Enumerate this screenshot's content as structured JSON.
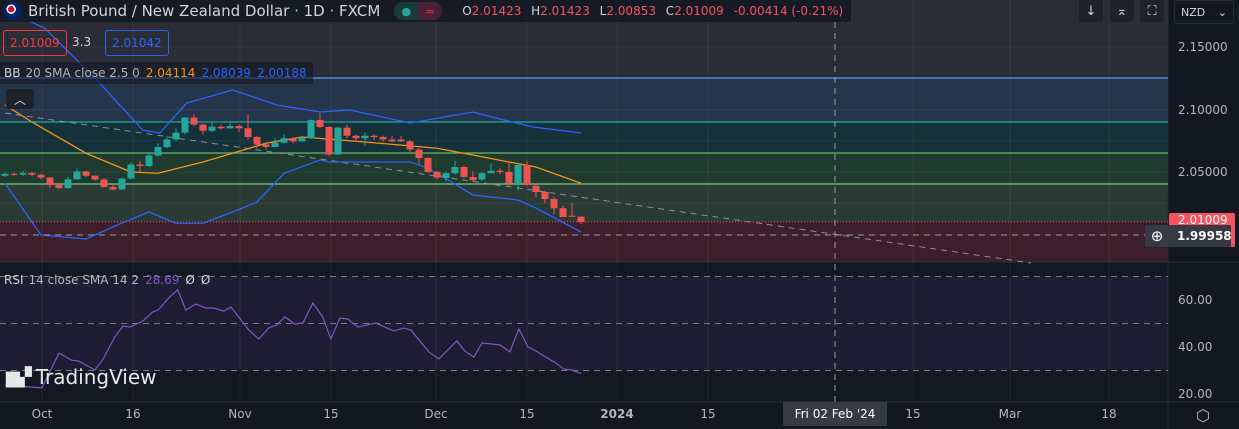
{
  "header": {
    "symbol_title": "British Pound / New Zealand Dollar · 1D · FXCM",
    "market_status_icon": "green-dot-icon",
    "data_delay_icon": "approx-icon",
    "ohlc": {
      "o_label": "O",
      "o": "2.01423",
      "h_label": "H",
      "h": "2.01423",
      "l_label": "L",
      "l": "2.00853",
      "c_label": "C",
      "c": "2.01009",
      "change": "-0.00414 (-0.21%)"
    },
    "sell_price": "2.01009",
    "spread": "3.3",
    "buy_price": "2.01042"
  },
  "indicators": {
    "bb": {
      "name": "BB",
      "params": "20 SMA close 2.5 0",
      "basis": "2.04114",
      "upper": "2.08039",
      "lower": "2.00188"
    },
    "rsi": {
      "name": "RSI",
      "params": "14 close SMA 14 2",
      "value": "28.69",
      "ma_value": "Ø",
      "extra": "Ø"
    }
  },
  "toolbar": {
    "currency": "NZD",
    "buttons": [
      "arrow-down-icon",
      "collapse-icon",
      "fullscreen-icon"
    ]
  },
  "price_axis": {
    "ticks": [
      "2.15000",
      "2.10000",
      "2.05000"
    ],
    "last_price": "2.01009",
    "crosshair_price": "1.99958"
  },
  "rsi_axis": {
    "ticks": [
      "60.00",
      "40.00",
      "20.00"
    ]
  },
  "time_axis": {
    "ticks": [
      "Oct",
      "16",
      "Nov",
      "15",
      "Dec",
      "15",
      "2024",
      "15",
      "15",
      "Mar",
      "18"
    ],
    "crosshair_date": "Fri 02 Feb '24"
  },
  "watermark": "TradingView",
  "colors": {
    "up": "#26a69a",
    "down": "#ef5350",
    "bb_basis": "#f7931a",
    "bb_band": "#2962ff",
    "rsi": "#7e57c2",
    "last_price": "#f7525f"
  },
  "chart_data": {
    "type": "candlestick",
    "price_range": [
      1.98,
      2.18
    ],
    "levels": [
      2.1252,
      2.09,
      2.0652,
      2.0404
    ],
    "candles": [
      [
        2.047,
        2.05,
        2.046,
        2.0485
      ],
      [
        2.0485,
        2.0495,
        2.047,
        2.048
      ],
      [
        2.048,
        2.051,
        2.047,
        2.0492
      ],
      [
        2.0492,
        2.05,
        2.0465,
        2.0478
      ],
      [
        2.0478,
        2.0485,
        2.044,
        2.0455
      ],
      [
        2.0455,
        2.046,
        2.037,
        2.0395
      ],
      [
        2.0395,
        2.041,
        2.036,
        2.0372
      ],
      [
        2.0372,
        2.046,
        2.0365,
        2.0442
      ],
      [
        2.0442,
        2.053,
        2.044,
        2.0505
      ],
      [
        2.0505,
        2.051,
        2.046,
        2.047
      ],
      [
        2.047,
        2.0475,
        2.043,
        2.044
      ],
      [
        2.044,
        2.045,
        2.0375,
        2.038
      ],
      [
        2.038,
        2.0395,
        2.0355,
        2.036
      ],
      [
        2.036,
        2.045,
        2.0355,
        2.0448
      ],
      [
        2.0448,
        2.0575,
        2.044,
        2.056
      ],
      [
        2.056,
        2.059,
        2.05,
        2.0548
      ],
      [
        2.0548,
        2.065,
        2.054,
        2.0632
      ],
      [
        2.0632,
        2.073,
        2.062,
        2.07
      ],
      [
        2.07,
        2.079,
        2.069,
        2.076
      ],
      [
        2.076,
        2.085,
        2.075,
        2.0815
      ],
      [
        2.0815,
        2.094,
        2.08,
        2.0935
      ],
      [
        2.0935,
        2.096,
        2.087,
        2.088
      ],
      [
        2.088,
        2.0885,
        2.08,
        2.083
      ],
      [
        2.083,
        2.09,
        2.082,
        2.0862
      ],
      [
        2.0862,
        2.088,
        2.084,
        2.085
      ],
      [
        2.085,
        2.089,
        2.0845,
        2.0868
      ],
      [
        2.0868,
        2.088,
        2.082,
        2.085
      ],
      [
        2.085,
        2.096,
        2.076,
        2.078
      ],
      [
        2.078,
        2.079,
        2.069,
        2.072
      ],
      [
        2.072,
        2.073,
        2.068,
        2.07
      ],
      [
        2.07,
        2.077,
        2.07,
        2.0735
      ],
      [
        2.0735,
        2.08,
        2.073,
        2.077
      ],
      [
        2.077,
        2.078,
        2.073,
        2.0745
      ],
      [
        2.0745,
        2.079,
        2.0745,
        2.077
      ],
      [
        2.077,
        2.092,
        2.0765,
        2.0915
      ],
      [
        2.0915,
        2.097,
        2.085,
        2.086
      ],
      [
        2.086,
        2.087,
        2.063,
        2.064
      ],
      [
        2.064,
        2.086,
        2.0635,
        2.0855
      ],
      [
        2.0855,
        2.088,
        2.077,
        2.079
      ],
      [
        2.079,
        2.08,
        2.074,
        2.077
      ],
      [
        2.077,
        2.0815,
        2.071,
        2.079
      ],
      [
        2.079,
        2.08,
        2.0755,
        2.078
      ],
      [
        2.078,
        2.079,
        2.074,
        2.076
      ],
      [
        2.076,
        2.079,
        2.074,
        2.0745
      ],
      [
        2.076,
        2.079,
        2.074,
        2.0745
      ],
      [
        2.0745,
        2.0755,
        2.066,
        2.068
      ],
      [
        2.068,
        2.069,
        2.056,
        2.0612
      ],
      [
        2.0612,
        2.062,
        2.049,
        2.05
      ],
      [
        2.05,
        2.051,
        2.044,
        2.0455
      ],
      [
        2.0452,
        2.0505,
        2.0425,
        2.049
      ],
      [
        2.049,
        2.059,
        2.048,
        2.054
      ],
      [
        2.054,
        2.055,
        2.045,
        2.046
      ],
      [
        2.046,
        2.0505,
        2.042,
        2.0435
      ],
      [
        2.044,
        2.05,
        2.043,
        2.049
      ],
      [
        2.049,
        2.057,
        2.049,
        2.051
      ],
      [
        2.051,
        2.053,
        2.048,
        2.05
      ],
      [
        2.05,
        2.059,
        2.038,
        2.041
      ],
      [
        2.0404,
        2.056,
        2.035,
        2.0556
      ],
      [
        2.0556,
        2.059,
        2.039,
        2.0396
      ],
      [
        2.039,
        2.04,
        2.03,
        2.034
      ],
      [
        2.034,
        2.035,
        2.025,
        2.0284
      ],
      [
        2.0284,
        2.03,
        2.016,
        2.021
      ],
      [
        2.021,
        2.023,
        2.014,
        2.014
      ],
      [
        2.015,
        2.025,
        2.0145,
        2.0148
      ],
      [
        2.01423,
        2.01423,
        2.00853,
        2.01009
      ]
    ],
    "bb_upper": [
      [
        0,
        2.1796
      ],
      [
        4.4,
        2.1652
      ],
      [
        10.2,
        2.1236
      ],
      [
        15.3,
        2.0836
      ],
      [
        17.2,
        2.0812
      ],
      [
        20.2,
        2.1052
      ],
      [
        25.3,
        2.1156
      ],
      [
        30.2,
        2.1036
      ],
      [
        35,
        2.098
      ],
      [
        38.3,
        2.0996
      ],
      [
        45,
        2.0892
      ],
      [
        52,
        2.098
      ],
      [
        55,
        2.0924
      ],
      [
        58.7,
        2.086
      ],
      [
        64,
        2.0812
      ]
    ],
    "bb_basis": [
      [
        0,
        2.1036
      ],
      [
        3,
        2.09
      ],
      [
        9,
        2.065
      ],
      [
        14,
        2.05
      ],
      [
        17,
        2.049
      ],
      [
        22,
        2.058
      ],
      [
        29,
        2.073
      ],
      [
        33,
        2.078
      ],
      [
        40,
        2.074
      ],
      [
        48,
        2.069
      ],
      [
        52,
        2.0636
      ],
      [
        56,
        2.058
      ],
      [
        59,
        2.054
      ],
      [
        64,
        2.041
      ]
    ],
    "bb_lower": [
      [
        0,
        2.041
      ],
      [
        4,
        1.9996
      ],
      [
        9,
        1.9964
      ],
      [
        13,
        2.0092
      ],
      [
        16,
        2.018
      ],
      [
        19,
        2.009
      ],
      [
        22,
        2.009
      ],
      [
        25,
        2.0172
      ],
      [
        28,
        2.026
      ],
      [
        31,
        2.049
      ],
      [
        35,
        2.0596
      ],
      [
        36,
        2.058
      ],
      [
        45,
        2.058
      ],
      [
        47,
        2.0532
      ],
      [
        52,
        2.0316
      ],
      [
        57,
        2.0276
      ],
      [
        59,
        2.0212
      ],
      [
        64,
        2.002
      ]
    ],
    "trend_line": [
      [
        0,
        2.0972
      ],
      [
        114,
        1.9772
      ]
    ],
    "rsi_range": [
      10,
      80
    ],
    "rsi_levels": [
      70,
      50,
      30
    ],
    "rsi": [
      [
        0,
        23.8
      ],
      [
        4.1,
        22.6
      ],
      [
        6,
        37.4
      ],
      [
        7.4,
        34.4
      ],
      [
        8.2,
        34
      ],
      [
        10,
        30.2
      ],
      [
        10.9,
        34.9
      ],
      [
        12.2,
        44.3
      ],
      [
        13.1,
        48.9
      ],
      [
        13.9,
        48.5
      ],
      [
        15.3,
        51
      ],
      [
        16.4,
        54.9
      ],
      [
        17,
        55.7
      ],
      [
        18.3,
        61.3
      ],
      [
        19.2,
        64.3
      ],
      [
        20.1,
        55.7
      ],
      [
        21.2,
        58.3
      ],
      [
        22.3,
        56.6
      ],
      [
        23.2,
        56.6
      ],
      [
        24.3,
        55.3
      ],
      [
        25.1,
        57
      ],
      [
        27.1,
        47.2
      ],
      [
        28.2,
        43.4
      ],
      [
        29.3,
        48.1
      ],
      [
        30.2,
        49.4
      ],
      [
        31.1,
        52.8
      ],
      [
        32.2,
        49.8
      ],
      [
        33.1,
        50.2
      ],
      [
        34.2,
        58.7
      ],
      [
        35.3,
        52.8
      ],
      [
        36.2,
        43.4
      ],
      [
        37.2,
        52.3
      ],
      [
        38.1,
        51.9
      ],
      [
        39.2,
        48.5
      ],
      [
        41.2,
        50.2
      ],
      [
        43.2,
        46.8
      ],
      [
        44.3,
        48.1
      ],
      [
        45.1,
        47.2
      ],
      [
        47.1,
        37.9
      ],
      [
        48.2,
        34.9
      ],
      [
        50.2,
        42.6
      ],
      [
        51.1,
        38.3
      ],
      [
        52.1,
        35.7
      ],
      [
        53,
        41.7
      ],
      [
        55,
        40.9
      ],
      [
        56.1,
        37.9
      ],
      [
        57.1,
        47.7
      ],
      [
        58.1,
        40
      ],
      [
        59,
        38.3
      ],
      [
        60.1,
        35.7
      ],
      [
        61.2,
        33.2
      ],
      [
        62.1,
        30.6
      ],
      [
        63,
        30.2
      ],
      [
        64,
        28.7
      ]
    ]
  }
}
